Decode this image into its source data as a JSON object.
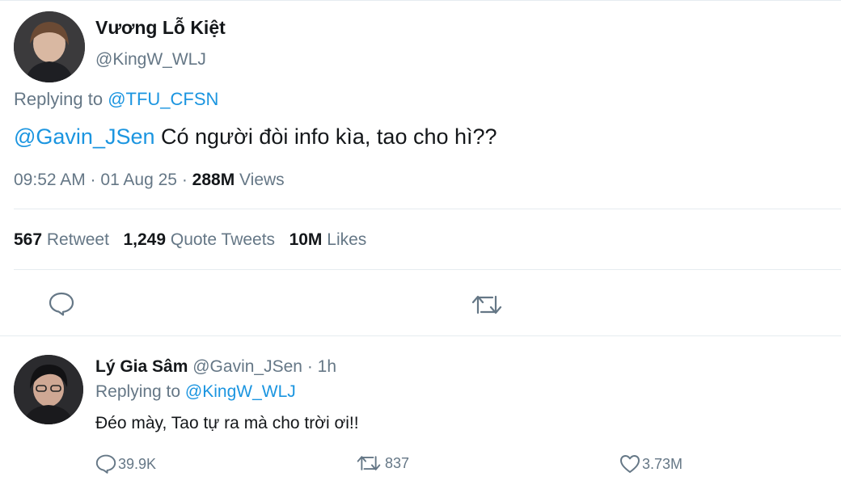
{
  "main_tweet": {
    "author_name": "Vương Lỗ Kiệt",
    "author_handle": "@KingW_WLJ",
    "replying_prefix": "Replying to",
    "replying_handle": "@TFU_CFSN",
    "mention": "@Gavin_JSen",
    "text": "Có người đòi info kìa, tao cho hì??",
    "timestamp": "09:52 AM · 01 Aug 25 · ",
    "views_count": "288M",
    "views_label": "Views"
  },
  "stats": {
    "retweet_count": "567",
    "retweet_label": "Retweet",
    "quote_count": "1,249",
    "quote_label": "Quote Tweets",
    "likes_count": "10M",
    "likes_label": "Likes"
  },
  "reply": {
    "author_name": "Lý Gia Sâm",
    "author_handle": "@Gavin_JSen",
    "time": "· 1h",
    "replying_prefix": "Replying to",
    "replying_handle": "@KingW_WLJ",
    "text": "Đéo mày, Tao tự ra mà cho trời ơi!!",
    "reply_count": "39.9K",
    "retweet_count": "837",
    "like_count": "3.73M"
  },
  "icons": {
    "reply": "speech-bubble-icon",
    "retweet": "retweet-arrows-icon",
    "like": "heart-icon"
  }
}
